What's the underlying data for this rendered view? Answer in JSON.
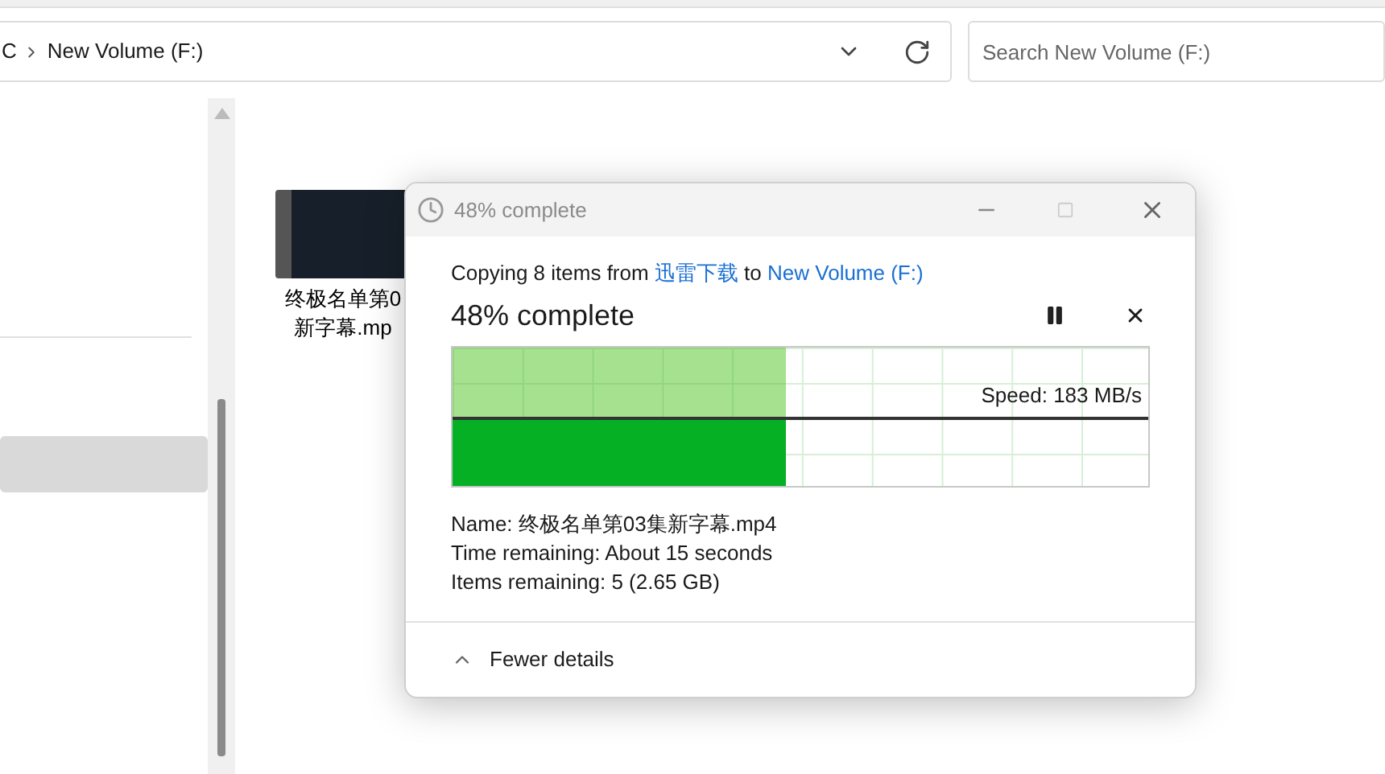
{
  "address_bar": {
    "breadcrumbs": [
      "C",
      "New Volume (F:)"
    ]
  },
  "search": {
    "placeholder": "Search New Volume (F:)"
  },
  "nav_pane": {
    "items": [
      {
        "selected": false
      },
      {
        "selected": true
      }
    ]
  },
  "files": [
    {
      "name_lines": [
        "终极名单第0",
        "新字幕.mp"
      ]
    }
  ],
  "dialog": {
    "title": "48% complete",
    "copy_parts": [
      {
        "text": "Copying 8 items from ",
        "kind": "plain"
      },
      {
        "text": "迅雷下载",
        "kind": "link"
      },
      {
        "text": " to ",
        "kind": "plain"
      },
      {
        "text": "New Volume (F:)",
        "kind": "link"
      }
    ],
    "heading": "48% complete",
    "progress": {
      "level": 0.48
    },
    "speed": "Speed: 183 MB/s",
    "details": [
      "Name: 终极名单第03集新字幕.mp4",
      "Time remaining: About 15 seconds",
      "Items remaining: 5 (2.65 GB)"
    ],
    "toggle": "Fewer details"
  }
}
